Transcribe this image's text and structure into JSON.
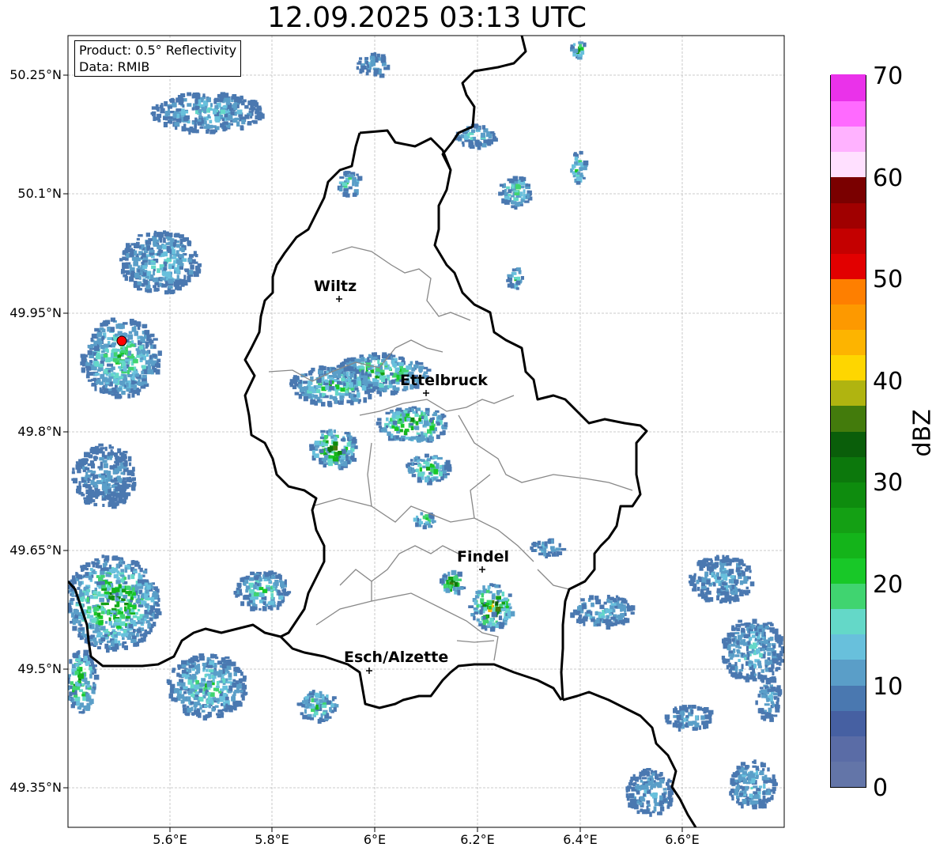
{
  "title": "12.09.2025 03:13 UTC",
  "infobox": {
    "product": "Product: 0.5° Reflectivity",
    "data": "Data: RMIB"
  },
  "lat_labels": [
    "50.25°N",
    "50.1°N",
    "49.95°N",
    "49.8°N",
    "49.65°N",
    "49.5°N",
    "49.35°N"
  ],
  "lon_labels": [
    "5.6°E",
    "5.8°E",
    "6°E",
    "6.2°E",
    "6.4°E",
    "6.6°E"
  ],
  "cities": [
    {
      "name": "Wiltz",
      "marker": "+"
    },
    {
      "name": "Ettelbruck",
      "marker": "+"
    },
    {
      "name": "Findel",
      "marker": "+"
    },
    {
      "name": "Esch/Alzette",
      "marker": "+"
    }
  ],
  "colorbar": {
    "label": "dBZ",
    "ticks": [
      "70",
      "60",
      "50",
      "40",
      "30",
      "20",
      "10",
      "0"
    ],
    "colors": [
      "#6375a8",
      "#5a6ca6",
      "#4660a2",
      "#4a78b0",
      "#5a9ec8",
      "#68c0dc",
      "#64d8c8",
      "#40d470",
      "#18c828",
      "#14b41a",
      "#14a014",
      "#0e8c0e",
      "#0c780c",
      "#0a5e0a",
      "#437b0c",
      "#b0b410",
      "#fed600",
      "#fdb400",
      "#fd9900",
      "#fe7f00",
      "#e20000",
      "#c40000",
      "#a00000",
      "#7a0000",
      "#ffe0ff",
      "#ffb2ff",
      "#ff6aff",
      "#ea32ea"
    ]
  },
  "radar_site": {
    "color": "#ff0000"
  }
}
